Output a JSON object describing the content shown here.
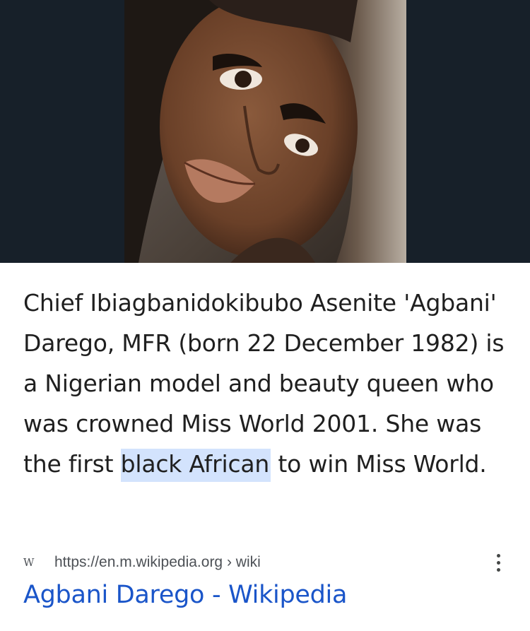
{
  "hero": {
    "image_alt": "Photo of Agbani Darego",
    "background_color": "#172029"
  },
  "snippet": {
    "text_before": "Chief Ibiagbanidokibubo Asenite 'Agbani' Darego, MFR (born 22 December 1982) is a Nigerian model and beauty queen who was crowned Miss World 2001. She was the first ",
    "highlight": "black African",
    "text_after": " to win Miss World.",
    "highlight_color": "#d3e3fd"
  },
  "source": {
    "favicon_letter": "W",
    "url": "https://en.m.wikipedia.org › wiki",
    "menu_icon": "more-vert-icon"
  },
  "result": {
    "title": "Agbani Darego - Wikipedia",
    "link_color": "#1a55c9"
  }
}
